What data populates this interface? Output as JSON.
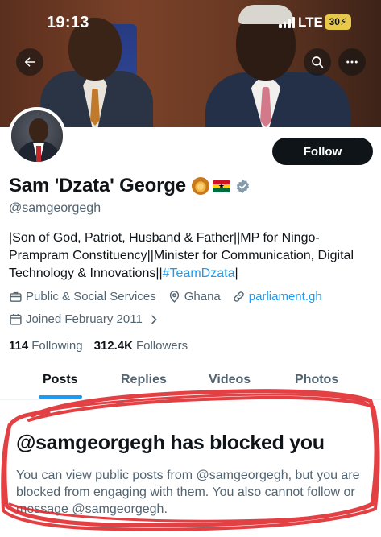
{
  "status_bar": {
    "time": "19:13",
    "network": "LTE",
    "battery": "30"
  },
  "profile": {
    "name": "Sam 'Dzata' George",
    "handle": "@samgeorgegh",
    "bio_text": "|Son of God, Patriot, Husband & Father||MP for Ningo-Prampram Constituency||Minister for Communication, Digital Technology & Innovations||",
    "bio_hashtag": "#TeamDzata",
    "bio_end": "|",
    "category": "Public & Social Services",
    "location": "Ghana",
    "website": "parliament.gh",
    "joined": "Joined February 2011",
    "following_count": "114",
    "following_label": "Following",
    "followers_count": "312.4K",
    "followers_label": "Followers"
  },
  "actions": {
    "follow_label": "Follow"
  },
  "tabs": [
    {
      "label": "Posts",
      "active": true
    },
    {
      "label": "Replies",
      "active": false
    },
    {
      "label": "Videos",
      "active": false
    },
    {
      "label": "Photos",
      "active": false
    }
  ],
  "blocked": {
    "title": "@samgeorgegh has blocked you",
    "message": "You can view public posts from @samgeorgegh, but you are blocked from engaging with them. You also cannot follow or message @samgeorgegh."
  },
  "colors": {
    "accent": "#1d9bf0",
    "text": "#0f1419",
    "secondary": "#536471",
    "annotation": "#e0262b"
  }
}
